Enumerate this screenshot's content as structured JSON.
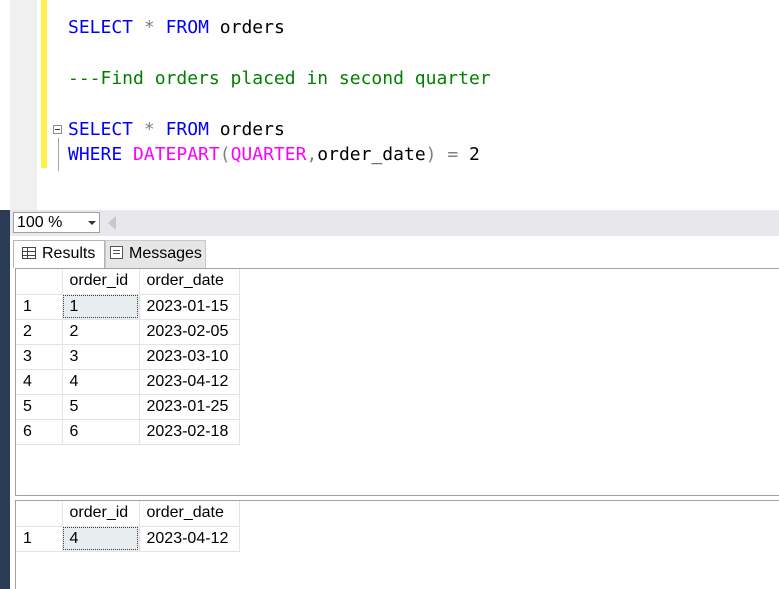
{
  "editor": {
    "line1": {
      "kw1": "SELECT",
      "op": "*",
      "kw2": "FROM",
      "table": "orders"
    },
    "comment": "---Find orders placed in second quarter",
    "line3": {
      "kw1": "SELECT",
      "op": "*",
      "kw2": "FROM",
      "table": "orders"
    },
    "line4": {
      "kw": "WHERE",
      "fn": "DATEPART",
      "open": "(",
      "arg1": "QUARTER",
      "comma": ",",
      "arg2": "order_date",
      "close": ")",
      "eq": "=",
      "val": "2"
    }
  },
  "zoom": {
    "value": "100 %"
  },
  "tabs": {
    "results": "Results",
    "messages": "Messages"
  },
  "result1": {
    "columns": [
      "order_id",
      "order_date"
    ],
    "rows": [
      {
        "rn": "1",
        "order_id": "1",
        "order_date": "2023-01-15"
      },
      {
        "rn": "2",
        "order_id": "2",
        "order_date": "2023-02-05"
      },
      {
        "rn": "3",
        "order_id": "3",
        "order_date": "2023-03-10"
      },
      {
        "rn": "4",
        "order_id": "4",
        "order_date": "2023-04-12"
      },
      {
        "rn": "5",
        "order_id": "5",
        "order_date": "2023-01-25"
      },
      {
        "rn": "6",
        "order_id": "6",
        "order_date": "2023-02-18"
      }
    ]
  },
  "result2": {
    "columns": [
      "order_id",
      "order_date"
    ],
    "rows": [
      {
        "rn": "1",
        "order_id": "4",
        "order_date": "2023-04-12"
      }
    ]
  },
  "colors": {
    "keyword": "#0000ff",
    "function": "#ff00ff",
    "comment": "#008000",
    "change_bar": "#ffef4f"
  }
}
